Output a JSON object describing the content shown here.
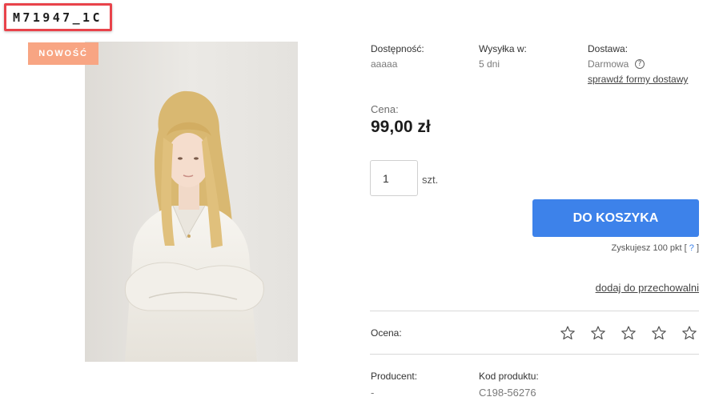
{
  "product": {
    "sku": "M71947_1C",
    "badge": "NOWOŚĆ"
  },
  "availability": {
    "label": "Dostępność:",
    "value": "aaaaa"
  },
  "shipping": {
    "label": "Wysyłka w:",
    "value": "5 dni"
  },
  "delivery": {
    "label": "Dostawa:",
    "value": "Darmowa",
    "help_icon": "?",
    "link": "sprawdź formy dostawy"
  },
  "price": {
    "label": "Cena:",
    "value": "99,00 zł"
  },
  "quantity": {
    "value": "1",
    "unit": "szt."
  },
  "cart": {
    "button": "DO KOSZYKA",
    "points_text": "Zyskujesz 100 pkt [",
    "points_help": "?",
    "points_close": "]"
  },
  "wishlist": {
    "link": "dodaj do przechowalni"
  },
  "rating": {
    "label": "Ocena:",
    "stars": 5,
    "filled": 0
  },
  "producer": {
    "label": "Producent:",
    "value": "-"
  },
  "product_code": {
    "label": "Kod produktu:",
    "value": "C198-56276"
  },
  "colors": {
    "badge": "#f8a583",
    "button": "#3d82ea",
    "highlight": "#e8434a"
  }
}
